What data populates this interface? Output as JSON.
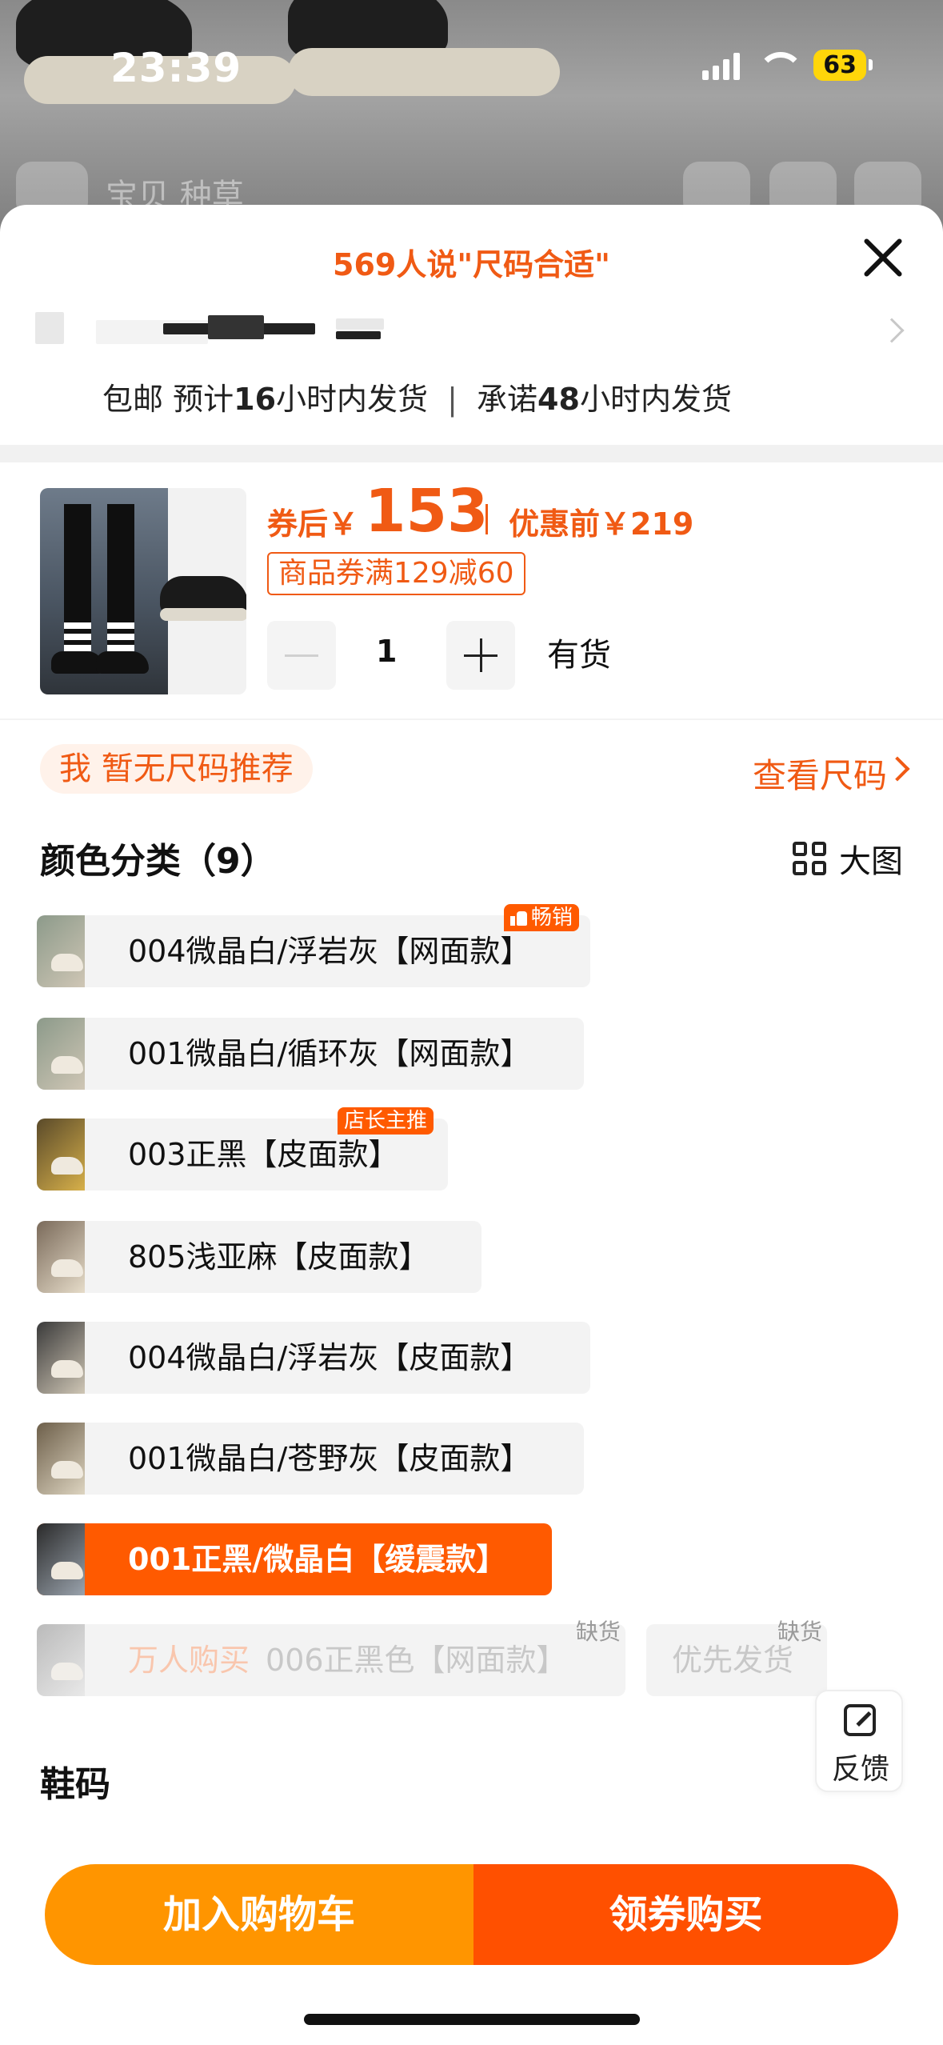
{
  "status_bar": {
    "time": "23:39",
    "battery": "63"
  },
  "background_nav": {
    "faded_text": "宝贝 种草"
  },
  "sheet": {
    "fit_banner": "569人说\"尺码合适\"",
    "shipping": {
      "free": "包邮",
      "estimate_prefix": "预计",
      "estimate_hours": "16",
      "estimate_suffix": "小时内发货",
      "separator": "|",
      "promise_prefix": "承诺",
      "promise_hours": "48",
      "promise_suffix": "小时内发货"
    }
  },
  "product": {
    "after_label": "券后￥",
    "price_after": "153",
    "price_before_label": "优惠前￥219",
    "coupon": "商品券满129减60",
    "quantity": "1",
    "stock": "有货"
  },
  "size_rec": {
    "text": "我 暂无尺码推荐",
    "link": "查看尺码"
  },
  "color_section": {
    "title": "颜色分类（9）",
    "big_image": "大图"
  },
  "color_options": [
    {
      "label": "004微晶白/浮岩灰【网面款】",
      "badge": "畅销"
    },
    {
      "label": "001微晶白/循环灰【网面款】"
    },
    {
      "label": "003正黑【皮面款】",
      "badge": "店长主推"
    },
    {
      "label": "805浅亚麻【皮面款】"
    },
    {
      "label": "004微晶白/浮岩灰【皮面款】"
    },
    {
      "label": "001微晶白/苍野灰【皮面款】"
    },
    {
      "label": "001正黑/微晶白【缓震款】",
      "selected": true
    },
    {
      "promo": "万人购买",
      "label": "006正黑色【网面款】",
      "status": "缺货"
    }
  ],
  "extra_option": {
    "label": "优先发货",
    "status": "缺货"
  },
  "size_section": {
    "title": "鞋码"
  },
  "feedback": {
    "label": "反馈"
  },
  "actions": {
    "add_cart": "加入购物车",
    "buy": "领券购买"
  },
  "colors": {
    "accent": "#f05a14",
    "cart_btn": "#ff9500",
    "buy_btn": "#ff5000",
    "selected_option": "#ff5a00"
  }
}
